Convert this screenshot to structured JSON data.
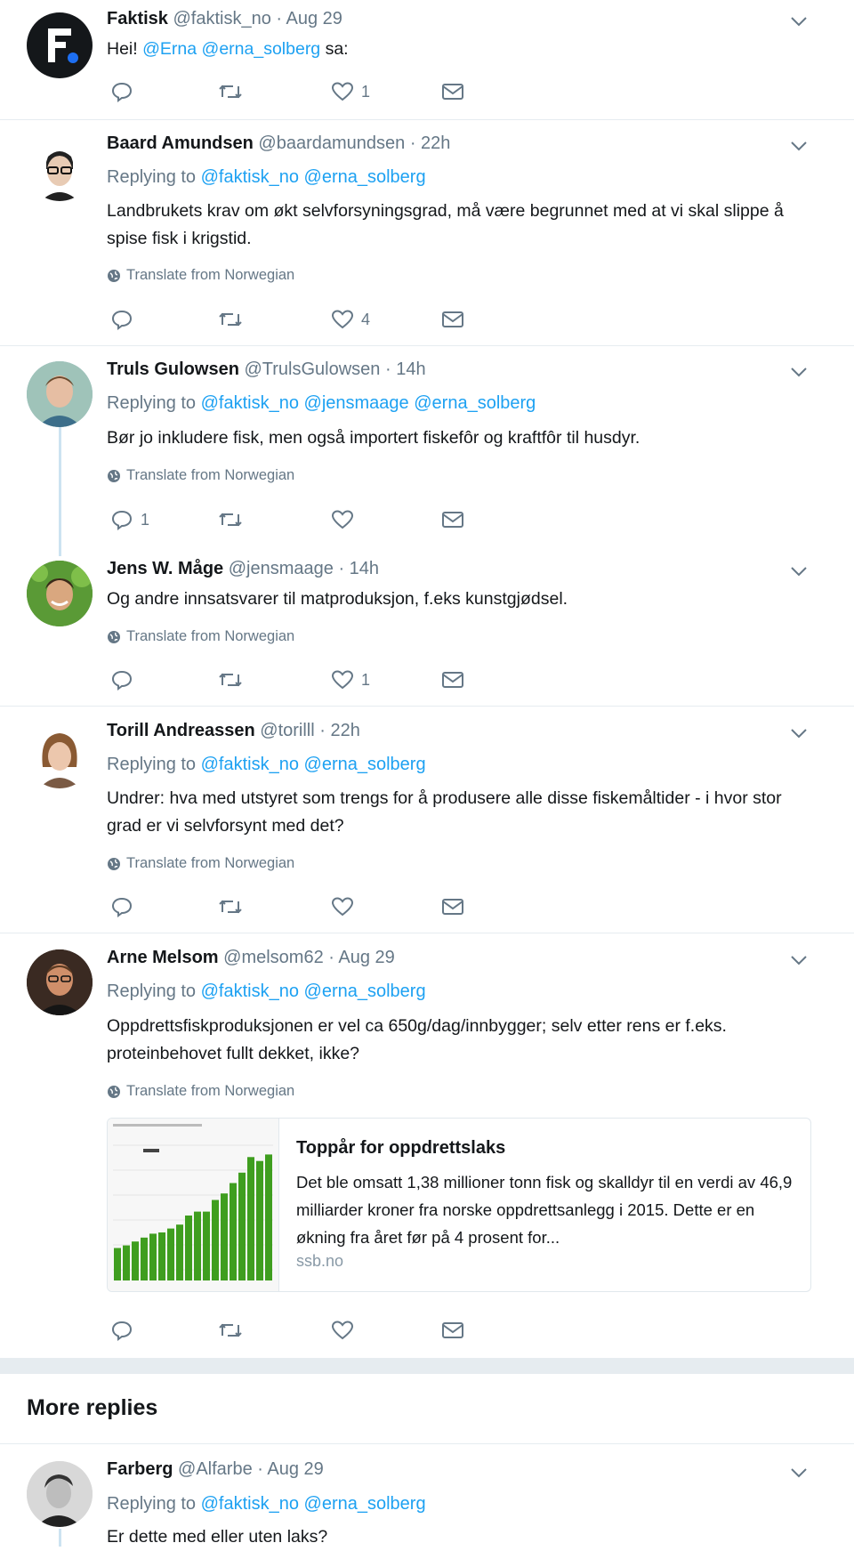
{
  "colors": {
    "link": "#1da1f2",
    "meta": "#657786",
    "chart_bar": "#3f9e1f"
  },
  "action_labels": {
    "reply": "reply-icon",
    "retweet": "retweet-icon",
    "like": "heart-icon",
    "dm": "mail-icon"
  },
  "tweets": [
    {
      "name": "Faktisk",
      "handle": "@faktisk_no",
      "time": "· Aug 29",
      "body_prefix": "Hei! ",
      "mention1": "@Erna",
      "mention2": "@erna_solberg",
      "body_suffix": " sa:",
      "reply_count": "",
      "like_count": "1"
    },
    {
      "name": "Baard Amundsen",
      "handle": "@baardamundsen",
      "time": "· 22h",
      "replying_prefix": "Replying to",
      "replying_to": "@faktisk_no @erna_solberg",
      "body": "Landbrukets krav om økt selvforsyningsgrad, må være begrunnet med at vi skal slippe å spise fisk i krigstid.",
      "translate": "Translate from Norwegian",
      "like_count": "4"
    },
    {
      "name": "Truls Gulowsen",
      "handle": "@TrulsGulowsen",
      "time": "· 14h",
      "replying_prefix": "Replying to",
      "replying_to": "@faktisk_no @jensmaage @erna_solberg",
      "body": "Bør jo inkludere fisk, men også importert fiskefôr og kraftfôr til husdyr.",
      "translate": "Translate from Norwegian",
      "reply_count": "1"
    },
    {
      "name": "Jens W. Måge",
      "handle": "@jensmaage",
      "time": "· 14h",
      "body": "Og andre innsatsvarer til matproduksjon, f.eks kunstgjødsel.",
      "translate": "Translate from Norwegian",
      "like_count": "1"
    },
    {
      "name": "Torill Andreassen",
      "handle": "@torilll",
      "time": "· 22h",
      "replying_prefix": "Replying to",
      "replying_to": "@faktisk_no @erna_solberg",
      "body": "Undrer: hva med utstyret som trengs for å produsere alle disse fiskemåltider - i hvor stor grad er vi selvforsynt med det?",
      "translate": "Translate from Norwegian"
    },
    {
      "name": "Arne Melsom",
      "handle": "@melsom62",
      "time": "· Aug 29",
      "replying_prefix": "Replying to",
      "replying_to": "@faktisk_no @erna_solberg",
      "body": "Oppdrettsfiskproduksjonen er vel ca 650g/dag/innbygger; selv etter rens er f.eks. proteinbehovet fullt dekket, ikke?",
      "translate": "Translate from Norwegian",
      "card": {
        "title": "Toppår for oppdrettslaks",
        "description": "Det ble omsatt 1,38 millioner tonn fisk og skalldyr til en verdi av 46,9 milliarder kroner fra norske oppdrettsanlegg i 2015. Dette er en økning fra året før på 4 prosent for...",
        "domain": "ssb.no"
      }
    },
    {
      "name": "Farberg",
      "handle": "@Alfarbe",
      "time": "· Aug 29",
      "replying_prefix": "Replying to",
      "replying_to": "@faktisk_no @erna_solberg",
      "body": "Er dette med eller uten laks?"
    }
  ],
  "more_replies": "More replies",
  "thumbnail_bars": [
    0.25,
    0.27,
    0.3,
    0.33,
    0.36,
    0.37,
    0.4,
    0.43,
    0.5,
    0.53,
    0.53,
    0.62,
    0.67,
    0.75,
    0.83,
    0.95,
    0.92,
    0.97
  ]
}
